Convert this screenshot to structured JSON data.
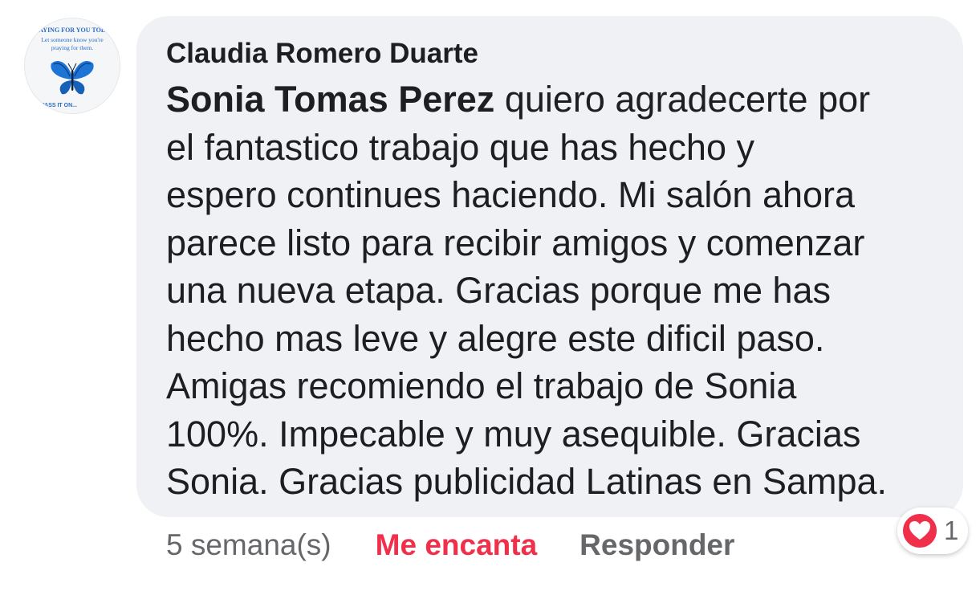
{
  "comment": {
    "author": "Claudia Romero Duarte",
    "avatar": {
      "icon": "butterfly-icon",
      "line1": "PRAYING FOR YOU TODAY",
      "line2": "Let someone know you're",
      "line3": "praying for them.",
      "line4": "PASS IT ON..."
    },
    "mention": "Sonia Tomas Perez",
    "lines": [
      " quiero agradecerte por",
      "el fantastico trabajo que has hecho y",
      "espero continues haciendo. Mi salón ahora",
      "parece listo para recibir amigos y comenzar",
      "una nueva etapa. Gracias porque me has",
      "hecho mas leve y alegre este dificil paso.",
      "Amigas recomiendo el trabajo de Sonia",
      "100%. Impecable y muy asequible. Gracias",
      "Sonia. Gracias publicidad Latinas en Sampa."
    ]
  },
  "actions": {
    "timestamp": "5 semana(s)",
    "love_label": "Me encanta",
    "reply_label": "Responder"
  },
  "reactions": {
    "icon": "heart-icon",
    "count": "1",
    "color": "#f0304b"
  }
}
